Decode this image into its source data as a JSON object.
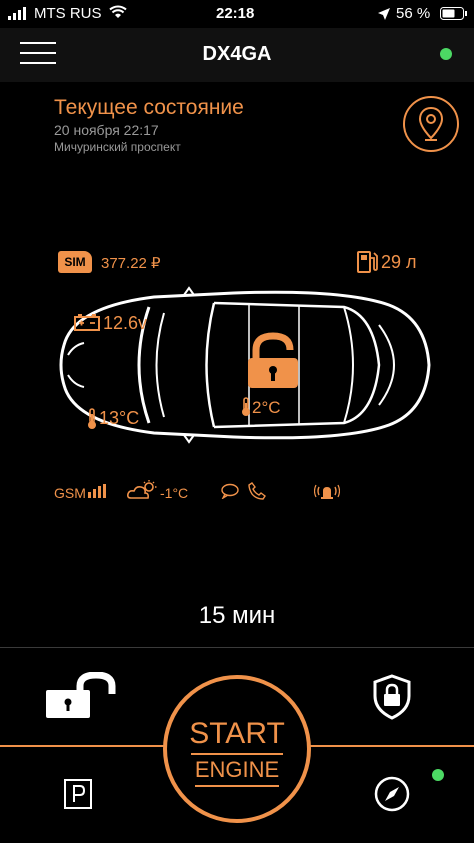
{
  "status_bar": {
    "carrier": "MTS RUS",
    "time": "22:18",
    "battery": "56 %"
  },
  "header": {
    "title": "DX4GA",
    "online_color": "#4cd964",
    "bg_color": "#111111"
  },
  "state": {
    "title": "Текущее состояние",
    "datetime": "20 ноября 22:17",
    "address": "Мичуринский проспект",
    "accent_color": "#f0924a"
  },
  "indicators": {
    "sim_label": "SIM",
    "balance": "377.22 ₽",
    "fuel": "29 л",
    "battery_voltage": "12.6v",
    "engine_temp": "13°C",
    "cabin_temp": "2°C",
    "gsm_label": "GSM",
    "outside_temp": "-1°C"
  },
  "timer": "15 мин",
  "controls": {
    "start_line1": "START",
    "start_line2": "ENGINE"
  }
}
